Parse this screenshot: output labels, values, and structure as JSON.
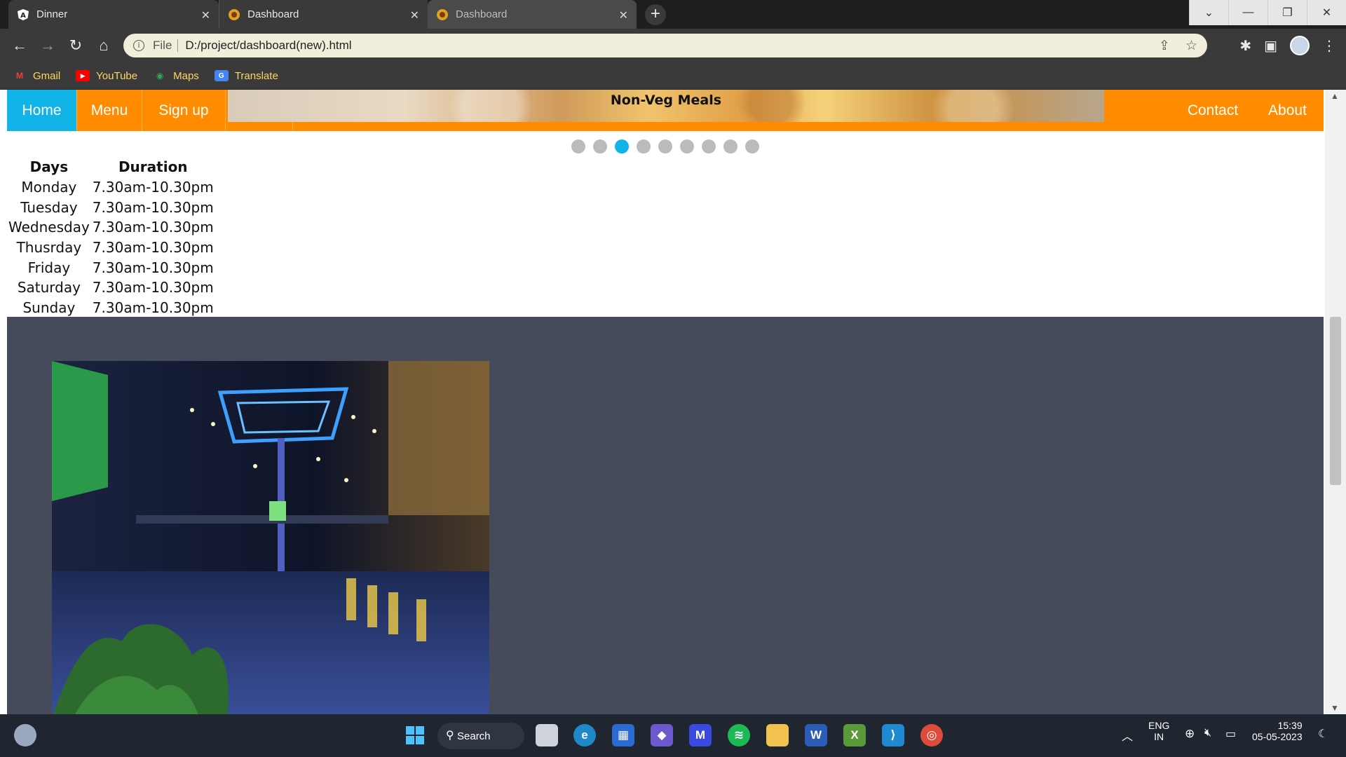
{
  "browser": {
    "tabs": [
      {
        "title": "Dinner",
        "favicon": "angular-icon"
      },
      {
        "title": "Dashboard",
        "favicon": "dashboard-favicon"
      },
      {
        "title": "Dashboard",
        "favicon": "dashboard-favicon"
      }
    ],
    "address": {
      "scheme_label": "File",
      "url": "D:/project/dashboard(new).html"
    },
    "bookmarks": [
      {
        "label": "Gmail",
        "icon": "gmail-icon"
      },
      {
        "label": "YouTube",
        "icon": "youtube-icon"
      },
      {
        "label": "Maps",
        "icon": "maps-icon"
      },
      {
        "label": "Translate",
        "icon": "translate-icon"
      }
    ]
  },
  "page": {
    "nav": {
      "home": "Home",
      "menu": "Menu",
      "signup": "Sign up",
      "contact": "Contact",
      "about": "About"
    },
    "slider": {
      "caption": "Non-Veg Meals",
      "dot_count": 9,
      "active_index": 2
    },
    "hours": {
      "headers": [
        "Days",
        "Duration"
      ],
      "rows": [
        [
          "Monday",
          "7.30am-10.30pm"
        ],
        [
          "Tuesday",
          "7.30am-10.30pm"
        ],
        [
          "Wednesday",
          "7.30am-10.30pm"
        ],
        [
          "Thusrday",
          "7.30am-10.30pm"
        ],
        [
          "Friday",
          "7.30am-10.30pm"
        ],
        [
          "Saturday",
          "7.30am-10.30pm"
        ],
        [
          "Sunday",
          "7.30am-10.30pm"
        ]
      ]
    }
  },
  "taskbar": {
    "search_label": "Search",
    "lang_top": "ENG",
    "lang_bottom": "IN",
    "time": "15:39",
    "date": "05-05-2023"
  },
  "colors": {
    "nav_orange": "#ff8c00",
    "nav_active": "#12b3e6",
    "gallery_bg": "#454b5b",
    "dot_active": "#12b3e6",
    "dot_inactive": "#bbbbbb"
  }
}
